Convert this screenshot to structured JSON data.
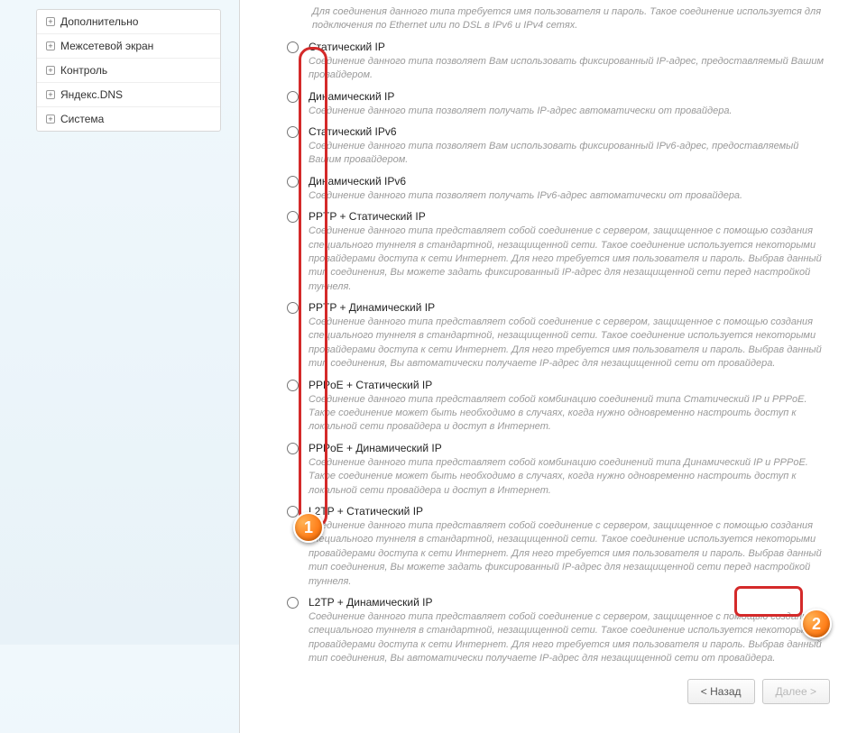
{
  "sidebar": {
    "items": [
      {
        "label": "Дополнительно"
      },
      {
        "label": "Межсетевой экран"
      },
      {
        "label": "Контроль"
      },
      {
        "label": "Яндекс.DNS"
      },
      {
        "label": "Система"
      }
    ]
  },
  "intro_desc": "Для соединения данного типа требуется имя пользователя и пароль. Такое соединение используется для подключения по Ethernet или по DSL в IPv6 и IPv4 сетях.",
  "options": [
    {
      "title": "Статический IP",
      "desc": "Соединение данного типа позволяет Вам использовать фиксированный IP-адрес, предоставляемый Вашим провайдером."
    },
    {
      "title": "Динамический IP",
      "desc": "Соединение данного типа позволяет получать IP-адрес автоматически от провайдера."
    },
    {
      "title": "Статический IPv6",
      "desc": "Соединение данного типа позволяет Вам использовать фиксированный IPv6-адрес, предоставляемый Вашим провайдером."
    },
    {
      "title": "Динамический IPv6",
      "desc": "Соединение данного типа позволяет получать IPv6-адрес автоматически от провайдера."
    },
    {
      "title": "PPTP + Статический IP",
      "desc": "Соединение данного типа представляет собой соединение с сервером, защищенное с помощью создания специального туннеля в стандартной, незащищенной сети. Такое соединение используется некоторыми провайдерами доступа к сети Интернет. Для него требуется имя пользователя и пароль. Выбрав данный тип соединения, Вы можете задать фиксированный IP-адрес для незащищенной сети перед настройкой туннеля."
    },
    {
      "title": "PPTP + Динамический IP",
      "desc": "Соединение данного типа представляет собой соединение с сервером, защищенное с помощью создания специального туннеля в стандартной, незащищенной сети. Такое соединение используется некоторыми провайдерами доступа к сети Интернет. Для него требуется имя пользователя и пароль. Выбрав данный тип соединения, Вы автоматически получаете IP-адрес для незащищенной сети от провайдера."
    },
    {
      "title": "PPPoE + Статический IP",
      "desc": "Соединение данного типа представляет собой комбинацию соединений типа Статический IP и PPPoE. Такое соединение может быть необходимо в случаях, когда нужно одновременно настроить доступ к локальной сети провайдера и доступ в Интернет."
    },
    {
      "title": "PPPoE + Динамический IP",
      "desc": "Соединение данного типа представляет собой комбинацию соединений типа Динамический IP и PPPoE. Такое соединение может быть необходимо в случаях, когда нужно одновременно настроить доступ к локальной сети провайдера и доступ в Интернет."
    },
    {
      "title": "L2TP + Статический IP",
      "desc": "Соединение данного типа представляет собой соединение с сервером, защищенное с помощью создания специального туннеля в стандартной, незащищенной сети. Такое соединение используется некоторыми провайдерами доступа к сети Интернет. Для него требуется имя пользователя и пароль. Выбрав данный тип соединения, Вы можете задать фиксированный IP-адрес для незащищенной сети перед настройкой туннеля."
    },
    {
      "title": "L2TP + Динамический IP",
      "desc": "Соединение данного типа представляет собой соединение с сервером, защищенное с помощью создания специального туннеля в стандартной, незащищенной сети. Такое соединение используется некоторыми провайдерами доступа к сети Интернет. Для него требуется имя пользователя и пароль. Выбрав данный тип соединения, Вы автоматически получаете IP-адрес для незащищенной сети от провайдера."
    }
  ],
  "buttons": {
    "back": "< Назад",
    "next": "Далее >"
  },
  "annotations": {
    "badge1": "1",
    "badge2": "2"
  }
}
